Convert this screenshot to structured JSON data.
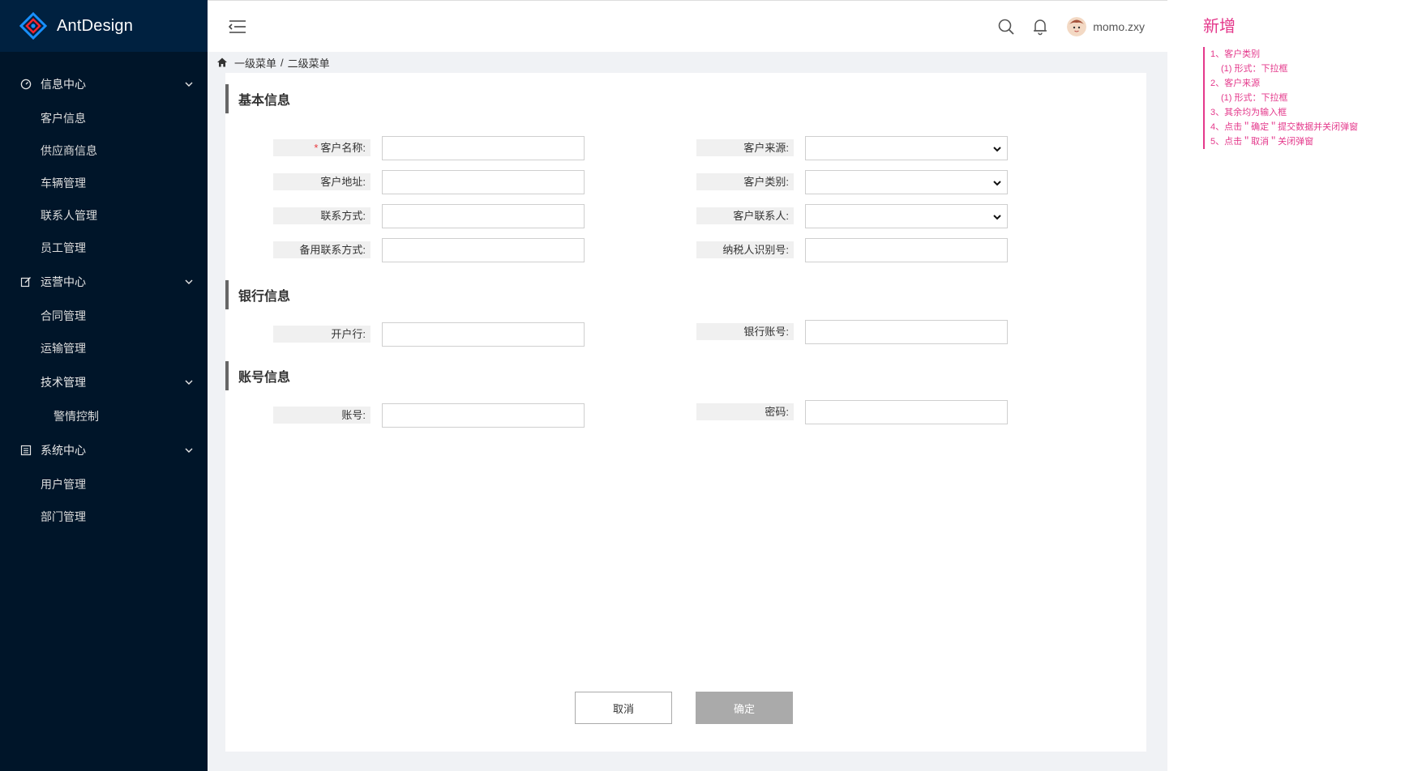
{
  "app": {
    "name": "AntDesign"
  },
  "sidebar": {
    "groups": [
      {
        "label": "信息中心",
        "icon": "dashboard-icon",
        "items": [
          "客户信息",
          "供应商信息",
          "车辆管理",
          "联系人管理",
          "员工管理"
        ]
      },
      {
        "label": "运营中心",
        "icon": "edit-icon",
        "items": [
          "合同管理",
          "运输管理"
        ]
      },
      {
        "label": "技术管理",
        "icon": "",
        "items": [
          "警情控制"
        ]
      },
      {
        "label": "系统中心",
        "icon": "list-icon",
        "items": [
          "用户管理",
          "部门管理"
        ]
      }
    ]
  },
  "header": {
    "username": "momo.zxy"
  },
  "breadcrumb": {
    "level1": "一级菜单",
    "separator": "/",
    "level2": "二级菜单"
  },
  "form": {
    "sections": {
      "basic": "基本信息",
      "bank": "银行信息",
      "account": "账号信息"
    },
    "required_mark": "*",
    "fields": {
      "customer_name": {
        "label": "客户名称:",
        "value": ""
      },
      "customer_source": {
        "label": "客户来源:",
        "value": ""
      },
      "customer_address": {
        "label": "客户地址:",
        "value": ""
      },
      "customer_type": {
        "label": "客户类别:",
        "value": ""
      },
      "contact_method": {
        "label": "联系方式:",
        "value": ""
      },
      "customer_contact": {
        "label": "客户联系人:",
        "value": ""
      },
      "backup_contact": {
        "label": "备用联系方式:",
        "value": ""
      },
      "taxpayer_id": {
        "label": "纳税人识别号:",
        "value": ""
      },
      "bank_name": {
        "label": "开户行:",
        "value": ""
      },
      "bank_account": {
        "label": "银行账号:",
        "value": ""
      },
      "account": {
        "label": "账号:",
        "value": ""
      },
      "password": {
        "label": "密码:",
        "value": ""
      }
    },
    "buttons": {
      "cancel": "取消",
      "confirm": "确定"
    }
  },
  "annotation": {
    "title": "新增",
    "lines": [
      "1、客户类别",
      "(1) 形式：下拉框",
      "2、客户来源",
      "(1) 形式：下拉框",
      "3、其余均为输入框",
      "4、点击＂确定＂提交数据并关闭弹窗",
      "5、点击＂取消＂关闭弹窗"
    ]
  },
  "colors": {
    "sidebar_bg": "#001529",
    "logo_bg": "#002140",
    "content_bg": "#f0f2f5",
    "annotation": "#e4388b",
    "confirm_button": "#aaaaaa"
  }
}
